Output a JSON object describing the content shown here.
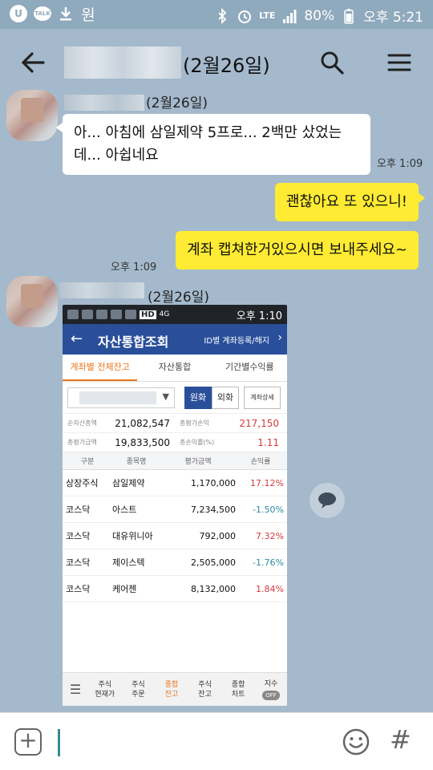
{
  "status_bar": {
    "network": "LTE",
    "battery": "80%",
    "time": "오후 5:21",
    "app_icons": [
      "u-plus-icon",
      "kakaotalk-icon",
      "download-icon",
      "won-icon"
    ],
    "won_symbol": "원",
    "talk_text": "TALK"
  },
  "header": {
    "date": "(2월26일)"
  },
  "messages": {
    "first": {
      "sender_date": "(2월26일)",
      "text": "아... 아침에 삼일제약 5프로... 2백만 샀었는데... 아쉽네요",
      "time": "오후 1:09"
    },
    "mine1": {
      "text": "괜찮아요 또 있으니!"
    },
    "mine2": {
      "text": "계좌 캡쳐한거있으시면 보내주세요~",
      "time": "오후 1:09"
    },
    "second": {
      "sender_date": "(2월26일)"
    }
  },
  "screenshot": {
    "status_time": "오후 1:10",
    "status_tags": [
      "HD",
      "4G"
    ],
    "title": "자산통합조회",
    "id_link": "ID별 계좌등록/해지",
    "tabs": [
      "계좌별 전체잔고",
      "자산통합",
      "기간별수익률"
    ],
    "currency_buttons": {
      "won": "원화",
      "fx": "외화",
      "detail": "계좌상세"
    },
    "summary": {
      "row1": {
        "k1": "순자산총액",
        "v1": "21,082,547",
        "k2": "총평가손익",
        "v2": "217,150"
      },
      "row2": {
        "k1": "총평가금액",
        "v1": "19,833,500",
        "k2": "총손익률(%)",
        "v2": "1.11"
      }
    },
    "table_headers": [
      "구분",
      "종목명",
      "평가금액",
      "손익률"
    ],
    "holdings": [
      {
        "type": "상장주식",
        "name": "삼일제약",
        "value": "1,170,000",
        "rate": "17.12%"
      },
      {
        "type": "코스닥",
        "name": "아스트",
        "value": "7,234,500",
        "rate": "-1.50%"
      },
      {
        "type": "코스닥",
        "name": "대유위니아",
        "value": "792,000",
        "rate": "7.32%"
      },
      {
        "type": "코스닥",
        "name": "제이스텍",
        "value": "2,505,000",
        "rate": "-1.76%"
      },
      {
        "type": "코스닥",
        "name": "케어젠",
        "value": "8,132,000",
        "rate": "1.84%"
      }
    ],
    "bottom_nav": [
      {
        "l1": "주식",
        "l2": "현재가"
      },
      {
        "l1": "주식",
        "l2": "주문"
      },
      {
        "l1": "종합",
        "l2": "잔고"
      },
      {
        "l1": "주식",
        "l2": "잔고"
      },
      {
        "l1": "종합",
        "l2": "차트"
      }
    ],
    "index_label": "지수",
    "index_toggle": "OFF"
  },
  "input": {
    "placeholder": ""
  },
  "colors": {
    "chat_bg": "#a4b9cc",
    "my_bubble": "#ffeb33",
    "app_header": "#2a4f9a",
    "positive": "#d23b3b",
    "negative": "#2d8b9f",
    "active_tab": "#e9761c"
  }
}
